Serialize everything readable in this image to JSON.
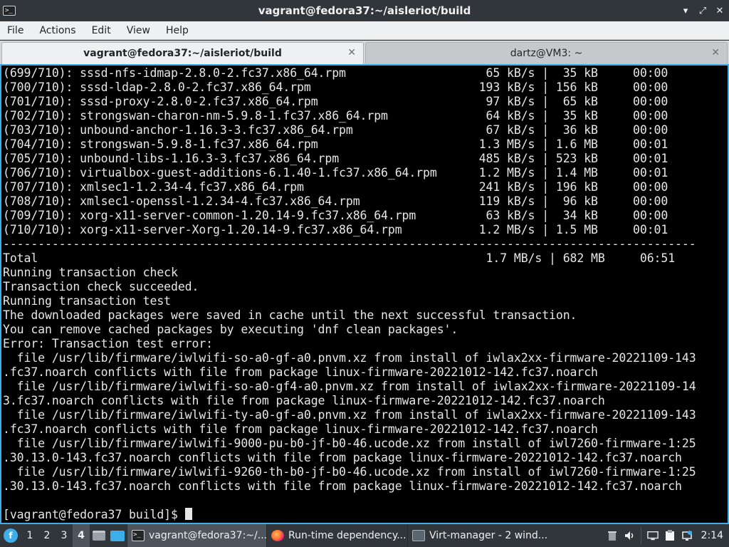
{
  "window": {
    "title": "vagrant@fedora37:~/aisleriot/build",
    "controls": {
      "minimize": "▾",
      "maximize": "⤢",
      "close": "✕"
    }
  },
  "menu": [
    "File",
    "Actions",
    "Edit",
    "View",
    "Help"
  ],
  "tabs": [
    {
      "label": "vagrant@fedora37:~/aisleriot/build",
      "active": true
    },
    {
      "label": "dartz@VM3: ~",
      "active": false
    }
  ],
  "terminal": {
    "lines": [
      "(699/710): sssd-nfs-idmap-2.8.0-2.fc37.x86_64.rpm                    65 kB/s |  35 kB     00:00",
      "(700/710): sssd-ldap-2.8.0-2.fc37.x86_64.rpm                        193 kB/s | 156 kB     00:00",
      "(701/710): sssd-proxy-2.8.0-2.fc37.x86_64.rpm                        97 kB/s |  65 kB     00:00",
      "(702/710): strongswan-charon-nm-5.9.8-1.fc37.x86_64.rpm              64 kB/s |  35 kB     00:00",
      "(703/710): unbound-anchor-1.16.3-3.fc37.x86_64.rpm                   67 kB/s |  36 kB     00:00",
      "(704/710): strongswan-5.9.8-1.fc37.x86_64.rpm                       1.3 MB/s | 1.6 MB     00:01",
      "(705/710): unbound-libs-1.16.3-3.fc37.x86_64.rpm                    485 kB/s | 523 kB     00:01",
      "(706/710): virtualbox-guest-additions-6.1.40-1.fc37.x86_64.rpm      1.2 MB/s | 1.4 MB     00:01",
      "(707/710): xmlsec1-1.2.34-4.fc37.x86_64.rpm                         241 kB/s | 196 kB     00:00",
      "(708/710): xmlsec1-openssl-1.2.34-4.fc37.x86_64.rpm                 119 kB/s |  96 kB     00:00",
      "(709/710): xorg-x11-server-common-1.20.14-9.fc37.x86_64.rpm          63 kB/s |  34 kB     00:00",
      "(710/710): xorg-x11-server-Xorg-1.20.14-9.fc37.x86_64.rpm           1.2 MB/s | 1.5 MB     00:01",
      "---------------------------------------------------------------------------------------------------",
      "Total                                                                1.7 MB/s | 682 MB     06:51",
      "Running transaction check",
      "Transaction check succeeded.",
      "Running transaction test",
      "The downloaded packages were saved in cache until the next successful transaction.",
      "You can remove cached packages by executing 'dnf clean packages'.",
      "Error: Transaction test error:",
      "  file /usr/lib/firmware/iwlwifi-so-a0-gf-a0.pnvm.xz from install of iwlax2xx-firmware-20221109-143",
      ".fc37.noarch conflicts with file from package linux-firmware-20221012-142.fc37.noarch",
      "  file /usr/lib/firmware/iwlwifi-so-a0-gf4-a0.pnvm.xz from install of iwlax2xx-firmware-20221109-14",
      "3.fc37.noarch conflicts with file from package linux-firmware-20221012-142.fc37.noarch",
      "  file /usr/lib/firmware/iwlwifi-ty-a0-gf-a0.pnvm.xz from install of iwlax2xx-firmware-20221109-143",
      ".fc37.noarch conflicts with file from package linux-firmware-20221012-142.fc37.noarch",
      "  file /usr/lib/firmware/iwlwifi-9000-pu-b0-jf-b0-46.ucode.xz from install of iwl7260-firmware-1:25",
      ".30.13.0-143.fc37.noarch conflicts with file from package linux-firmware-20221012-142.fc37.noarch",
      "  file /usr/lib/firmware/iwlwifi-9260-th-b0-jf-b0-46.ucode.xz from install of iwl7260-firmware-1:25",
      ".30.13.0-143.fc37.noarch conflicts with file from package linux-firmware-20221012-142.fc37.noarch",
      ""
    ],
    "prompt": "[vagrant@fedora37 build]$ "
  },
  "taskbar": {
    "desktops": [
      "1",
      "2",
      "3",
      "4"
    ],
    "active_desktop": "4",
    "tasks": [
      {
        "label": "vagrant@fedora37:~/...",
        "icon": "terminal-icon",
        "active": true
      },
      {
        "label": "Run-time dependency...",
        "icon": "firefox-icon",
        "active": false
      },
      {
        "label": "Virt-manager - 2 wind...",
        "icon": "virt-manager-icon",
        "active": false
      }
    ],
    "tray_icons": [
      "trash-icon",
      "volume-icon",
      "display-icon",
      "clipboard-icon",
      "network-icon"
    ],
    "clock": "2:14"
  }
}
